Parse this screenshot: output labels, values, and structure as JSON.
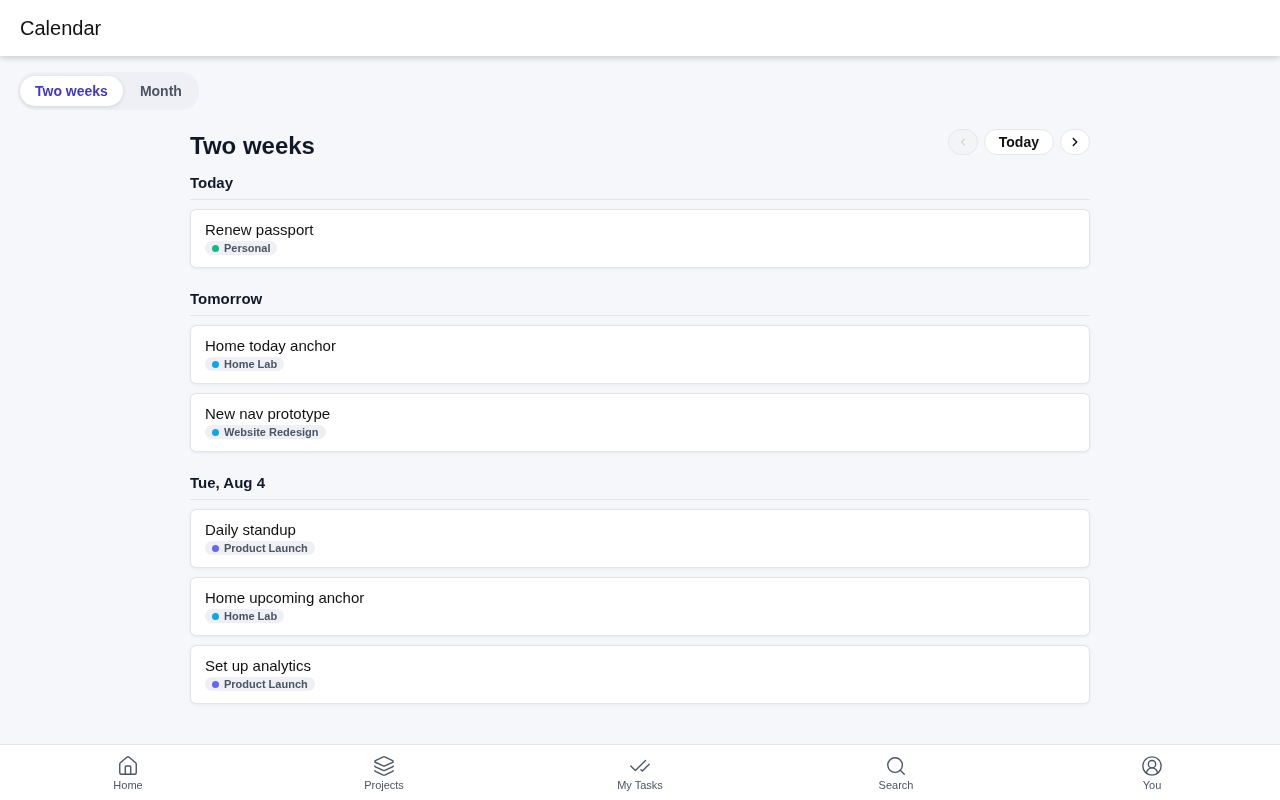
{
  "header": {
    "title": "Calendar"
  },
  "view_tabs": [
    {
      "label": "Two weeks",
      "selected": true
    },
    {
      "label": "Month",
      "selected": false
    }
  ],
  "page_title": "Two weeks",
  "nav": {
    "prev": {
      "disabled": true
    },
    "today": "Today",
    "next": {
      "disabled": false
    }
  },
  "sections": [
    {
      "heading": "Today",
      "tasks": [
        {
          "title": "Renew passport",
          "project": "Personal",
          "color": "#10b981"
        }
      ]
    },
    {
      "heading": "Tomorrow",
      "tasks": [
        {
          "title": "Home today anchor",
          "project": "Home Lab",
          "color": "#0ea5e9"
        },
        {
          "title": "New nav prototype",
          "project": "Website Redesign",
          "color": "#0ea5e9"
        }
      ]
    },
    {
      "heading": "Tue, Aug 4",
      "tasks": [
        {
          "title": "Daily standup",
          "project": "Product Launch",
          "color": "#6366f1"
        },
        {
          "title": "Home upcoming anchor",
          "project": "Home Lab",
          "color": "#0ea5e9"
        },
        {
          "title": "Set up analytics",
          "project": "Product Launch",
          "color": "#6366f1"
        }
      ]
    }
  ],
  "bottom_nav": [
    {
      "kind": "home",
      "label": "Home",
      "selected": false
    },
    {
      "kind": "projects",
      "label": "Projects",
      "selected": false
    },
    {
      "kind": "tasks",
      "label": "My Tasks",
      "selected": false
    },
    {
      "kind": "search",
      "label": "Search",
      "selected": false
    },
    {
      "kind": "you",
      "label": "You",
      "selected": false
    }
  ]
}
